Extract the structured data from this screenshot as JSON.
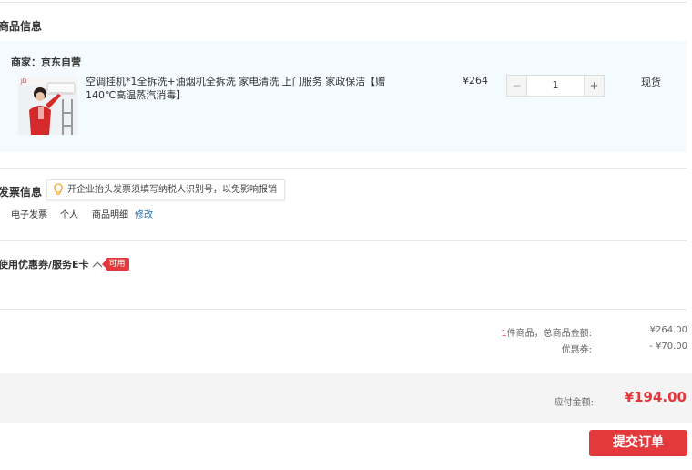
{
  "goods_section": {
    "title": "商品信息",
    "merchant": "商家：京东自营",
    "product_name": "空调挂机*1全拆洗+油烟机全拆洗 家电清洗 上门服务 家政保洁【赠140℃高温蒸汽消毒】",
    "price": "¥264",
    "quantity": "1",
    "minus_label": "−",
    "plus_label": "+",
    "stock_status": "现货"
  },
  "invoice_section": {
    "title": "发票信息",
    "tip": "开企业抬头发票须填写纳税人识别号，以免影响报销",
    "type": "电子发票",
    "holder": "个人",
    "content": "商品明细",
    "edit_label": "修改"
  },
  "coupon_section": {
    "title": "使用优惠券/服务E卡",
    "badge": "可用"
  },
  "summary": {
    "item_count": "1",
    "goods_total_label": "件商品，总商品金额:",
    "goods_total_value": "¥264.00",
    "discount_label": "优惠券:",
    "discount_value": "- ¥70.00",
    "payable_label": "应付金额:",
    "payable_value": "¥194.00"
  },
  "submit_label": "提交订单",
  "icons": {
    "bulb": "lightbulb-icon",
    "chevron": "chevron-up-icon"
  },
  "colors": {
    "accent": "#e4393c",
    "link": "#1f6fb5",
    "goods_bg": "#f3fbfe"
  }
}
